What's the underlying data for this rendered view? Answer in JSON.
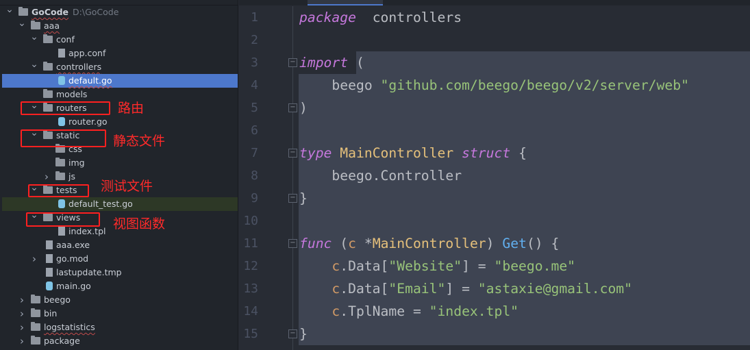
{
  "project_tree": [
    {
      "label": "GoCode",
      "hint": "D:\\GoCode",
      "depth": 0,
      "kind": "folder",
      "arrow": "open",
      "squig": true,
      "bold": true
    },
    {
      "label": "aaa",
      "depth": 1,
      "kind": "folder",
      "arrow": "open",
      "squig": true
    },
    {
      "label": "conf",
      "depth": 2,
      "kind": "folder",
      "arrow": "open"
    },
    {
      "label": "app.conf",
      "depth": 3,
      "kind": "file"
    },
    {
      "label": "controllers",
      "depth": 2,
      "kind": "folder",
      "arrow": "open",
      "squig": true
    },
    {
      "label": "default.go",
      "depth": 3,
      "kind": "go",
      "selected": true,
      "squig": true
    },
    {
      "label": "models",
      "depth": 2,
      "kind": "folder"
    },
    {
      "label": "routers",
      "depth": 2,
      "kind": "folder",
      "arrow": "open"
    },
    {
      "label": "router.go",
      "depth": 3,
      "kind": "go"
    },
    {
      "label": "static",
      "depth": 2,
      "kind": "folder",
      "arrow": "open"
    },
    {
      "label": "css",
      "depth": 3,
      "kind": "folder"
    },
    {
      "label": "img",
      "depth": 3,
      "kind": "folder"
    },
    {
      "label": "js",
      "depth": 3,
      "kind": "folder",
      "arrow": "closed"
    },
    {
      "label": "tests",
      "depth": 2,
      "kind": "folder",
      "arrow": "open"
    },
    {
      "label": "default_test.go",
      "depth": 3,
      "kind": "go",
      "highlight": true
    },
    {
      "label": "views",
      "depth": 2,
      "kind": "folder",
      "arrow": "open"
    },
    {
      "label": "index.tpl",
      "depth": 3,
      "kind": "file"
    },
    {
      "label": "aaa.exe",
      "depth": 2,
      "kind": "file"
    },
    {
      "label": "go.mod",
      "depth": 2,
      "kind": "file",
      "arrow": "closed"
    },
    {
      "label": "lastupdate.tmp",
      "depth": 2,
      "kind": "file"
    },
    {
      "label": "main.go",
      "depth": 2,
      "kind": "go"
    },
    {
      "label": "beego",
      "depth": 1,
      "kind": "folder",
      "arrow": "closed"
    },
    {
      "label": "bin",
      "depth": 1,
      "kind": "folder",
      "arrow": "closed"
    },
    {
      "label": "logstatistics",
      "depth": 1,
      "kind": "folder",
      "arrow": "closed",
      "squig": true
    },
    {
      "label": "package",
      "depth": 1,
      "kind": "folder",
      "arrow": "closed"
    }
  ],
  "annotations": [
    {
      "text": "路由",
      "target": "routers"
    },
    {
      "text": "静态文件",
      "target": "static"
    },
    {
      "text": "测试文件",
      "target": "tests"
    },
    {
      "text": "视图函数",
      "target": "views"
    }
  ],
  "code_lines": [
    [
      [
        "kw",
        "package"
      ],
      [
        "",
        "  controllers"
      ]
    ],
    [],
    [
      [
        "kw",
        "import"
      ],
      [
        "",
        " ("
      ]
    ],
    [
      [
        "",
        "    beego "
      ],
      [
        "str",
        "\"github.com/beego/beego/v2/server/web\""
      ]
    ],
    [
      [
        "",
        ")"
      ]
    ],
    [],
    [
      [
        "kw",
        "type"
      ],
      [
        "",
        " "
      ],
      [
        "ty",
        "MainController"
      ],
      [
        "",
        " "
      ],
      [
        "kw",
        "struct"
      ],
      [
        "",
        " {"
      ]
    ],
    [
      [
        "",
        "    beego.Controller"
      ]
    ],
    [
      [
        "",
        "}"
      ]
    ],
    [],
    [
      [
        "kw",
        "func"
      ],
      [
        "",
        " ("
      ],
      [
        "par",
        "c"
      ],
      [
        "",
        " *"
      ],
      [
        "ty",
        "MainController"
      ],
      [
        "",
        ") "
      ],
      [
        "fn",
        "Get"
      ],
      [
        "",
        "() {"
      ]
    ],
    [
      [
        "par",
        "    c"
      ],
      [
        "",
        ".Data["
      ],
      [
        "str",
        "\"Website\""
      ],
      [
        "",
        "] = "
      ],
      [
        "str",
        "\"beego.me\""
      ]
    ],
    [
      [
        "par",
        "    c"
      ],
      [
        "",
        ".Data["
      ],
      [
        "str",
        "\"Email\""
      ],
      [
        "",
        "] = "
      ],
      [
        "str",
        "\"astaxie@gmail.com\""
      ]
    ],
    [
      [
        "par",
        "    c"
      ],
      [
        "",
        ".TplName = "
      ],
      [
        "str",
        "\"index.tpl\""
      ]
    ],
    [
      [
        "",
        "}"
      ]
    ]
  ],
  "colors": {
    "keyword": "#c678dd",
    "type": "#e5c07b",
    "string": "#98c379",
    "function": "#61afef",
    "receiver": "#d19a66",
    "selection": "#3e4452",
    "tree_selection": "#4d78cc",
    "annotation": "#ff2020"
  }
}
